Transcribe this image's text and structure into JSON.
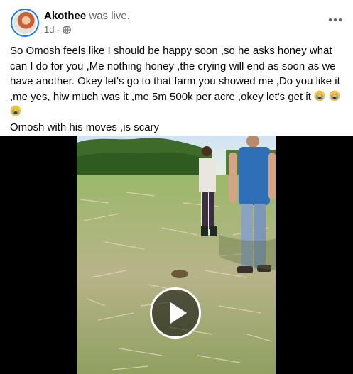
{
  "post": {
    "author_name": "Akothee",
    "author_action": "was live.",
    "timestamp": "1d",
    "separator": "·",
    "privacy_icon": "globe-icon",
    "more_icon": "more-options-icon",
    "caption_main": "So Omosh feels like I should be happy soon ,so he asks honey what can I do for you ,Me nothing honey ,the crying will end as soon as we have another.  Okey let's go to that farm you showed me ,Do you like it ,me yes, hiw much was it ,me 5m 500k per acre ,okey let's get it",
    "caption_second": "Omosh with his moves ,is scary",
    "emoji": "crying-face-emoji",
    "emoji_count": 3
  },
  "video": {
    "play_icon": "play-icon"
  },
  "colors": {
    "name_text": "#050505",
    "meta_text": "#65676b",
    "avatar_ring": "#1877f2",
    "video_background": "#000000"
  }
}
